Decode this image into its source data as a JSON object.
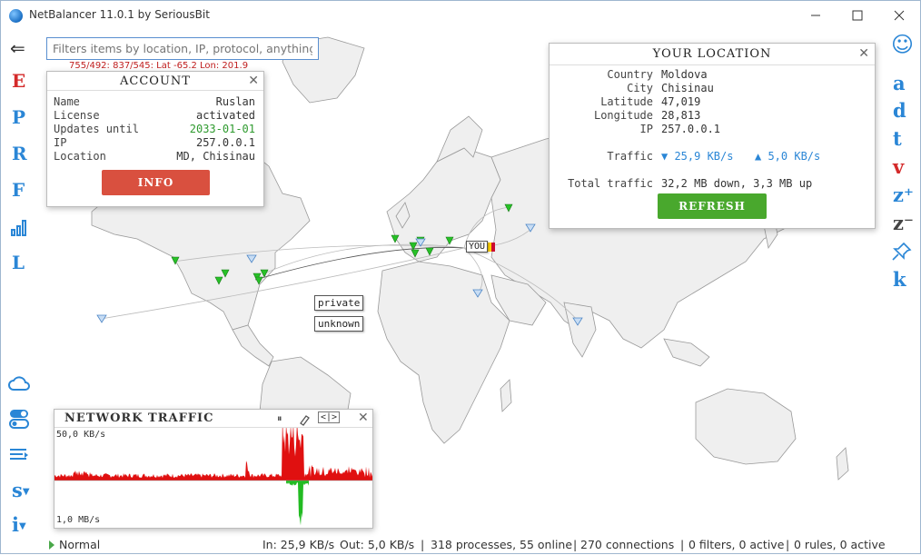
{
  "window": {
    "title": "NetBalancer 11.0.1 by SeriousBit",
    "minimize": "—",
    "maximize": "☐",
    "close": "✕"
  },
  "filter": {
    "placeholder": "Filters items by location, IP, protocol, anything...",
    "coords": "755/492: 837/545: Lat -65.2 Lon: 201.9"
  },
  "left_toolbar": {
    "back": "⇐",
    "letters": [
      {
        "label": "E",
        "color": "#d42a2a"
      },
      {
        "label": "P",
        "color": "#2a86d6"
      },
      {
        "label": "R",
        "color": "#2a86d6"
      },
      {
        "label": "F",
        "color": "#2a86d6"
      },
      {
        "label": "L",
        "color": "#2a86d6"
      }
    ],
    "bottom_s": "s",
    "bottom_i": "i",
    "icons": [
      "back-arrow-icon",
      "bar-chart-icon",
      "cloud-icon",
      "toggle-icon",
      "list-icon",
      "caret-down-icon"
    ]
  },
  "right_toolbar": {
    "smiley": "☺",
    "letters": [
      {
        "label": "a",
        "color": "#2a86d6"
      },
      {
        "label": "d",
        "color": "#2a86d6"
      },
      {
        "label": "t",
        "color": "#2a86d6"
      },
      {
        "label": "v",
        "color": "#d42a2a"
      },
      {
        "label": "z⁺",
        "color": "#2a86d6"
      },
      {
        "label": "z⁻",
        "color": "#444444"
      },
      {
        "label": "k",
        "color": "#2a86d6"
      }
    ],
    "icons": [
      "smiley-icon",
      "pin-icon"
    ]
  },
  "account": {
    "title": "ACCOUNT",
    "rows": [
      {
        "label": "Name",
        "value": "Ruslan"
      },
      {
        "label": "License",
        "value": "activated"
      },
      {
        "label": "Updates until",
        "value": "2033-01-01"
      },
      {
        "label": "IP",
        "value": "257.0.0.1"
      },
      {
        "label": "Location",
        "value": "MD, Chisinau"
      }
    ],
    "info_button": "INFO",
    "close": "✕"
  },
  "location": {
    "title": "YOUR LOCATION",
    "country_label": "Country",
    "country": "Moldova",
    "city_label": "City",
    "city": "Chisinau",
    "lat_label": "Latitude",
    "lat": "47,019",
    "lon_label": "Longitude",
    "lon": "28,813",
    "ip_label": "IP",
    "ip": "257.0.0.1",
    "traffic_label": "Traffic",
    "traffic_down": "▼ 25,9 KB/s",
    "traffic_up": "▲ 5,0 KB/s",
    "total_label": "Total traffic",
    "total": "32,2 MB down, 3,3 MB up",
    "refresh_button": "REFRESH",
    "close": "✕"
  },
  "map_labels": {
    "you": "YOU",
    "private": "private",
    "unknown": "unknown"
  },
  "network_traffic": {
    "title": "NETWORK TRAFFIC",
    "top_scale": "50,0 KB/s",
    "bottom_scale": "1,0 MB/s",
    "pause": "⏸",
    "nav": "<|>",
    "close": "✕",
    "download_color": "#e01010",
    "upload_color": "#22bb22"
  },
  "status": {
    "mode": "Normal",
    "in": "In: 25,9 KB/s",
    "out": "Out: 5,0 KB/s",
    "processes": "318 processes, 55 online",
    "connections": "270 connections",
    "filters": "0 filters, 0 active",
    "rules": "0 rules, 0 active",
    "sep": "|"
  },
  "colors": {
    "accent_blue": "#2a86d6",
    "accent_red": "#d42a2a",
    "marker_green": "#27c127",
    "marker_blue": "#8ab4e0"
  }
}
